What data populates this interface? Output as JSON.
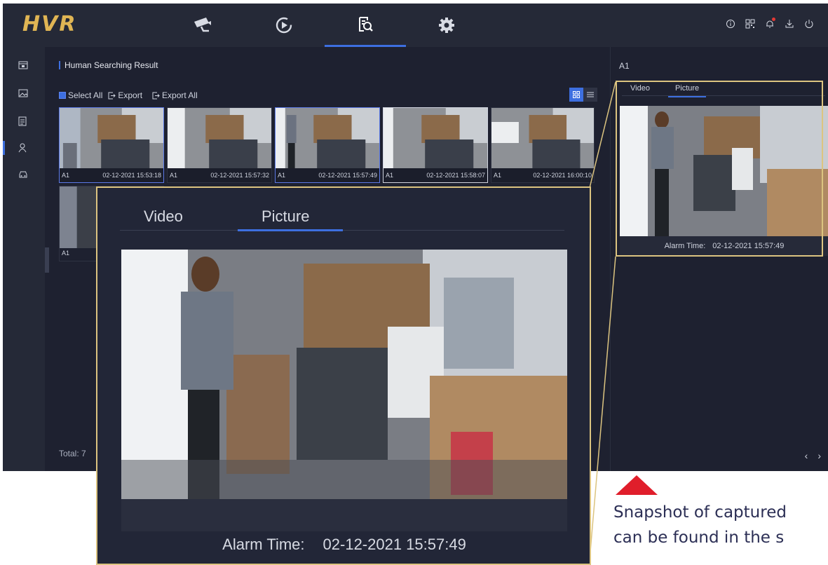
{
  "app": {
    "logo": "HVR"
  },
  "topnav": {
    "items": [
      {
        "name": "live-view",
        "icon": "camera-icon"
      },
      {
        "name": "playback",
        "icon": "playback-icon"
      },
      {
        "name": "search",
        "icon": "search-file-icon",
        "active": true
      },
      {
        "name": "configuration",
        "icon": "gear-icon"
      }
    ],
    "right_icons": [
      "info-icon",
      "qr-code-icon",
      "bell-icon",
      "download-icon",
      "power-icon"
    ]
  },
  "sidebar": {
    "items": [
      {
        "icon": "video-file-icon"
      },
      {
        "icon": "picture-icon"
      },
      {
        "icon": "document-icon"
      },
      {
        "icon": "person-icon",
        "active": true
      },
      {
        "icon": "vehicle-icon"
      }
    ]
  },
  "main": {
    "title": "Human Searching Result",
    "toolbar": {
      "select_all": "Select All",
      "export": "Export",
      "export_all": "Export All"
    },
    "results": [
      {
        "channel": "A1",
        "time": "02-12-2021 15:53:18"
      },
      {
        "channel": "A1",
        "time": "02-12-2021 15:57:32"
      },
      {
        "channel": "A1",
        "time": "02-12-2021 15:57:49"
      },
      {
        "channel": "A1",
        "time": "02-12-2021 15:58:07"
      },
      {
        "channel": "A1",
        "time": "02-12-2021 16:00:10"
      },
      {
        "channel": "A1",
        "time": ""
      }
    ],
    "total": "Total: 7"
  },
  "detail": {
    "title": "A1",
    "tab_video": "Video",
    "tab_picture": "Picture",
    "alarm_label": "Alarm Time:",
    "alarm_time": "02-12-2021 15:57:49",
    "prev": "‹",
    "next": "›"
  },
  "callout": {
    "tab_video": "Video",
    "tab_picture": "Picture",
    "alarm_label": "Alarm Time:",
    "alarm_time": "02-12-2021 15:57:49"
  },
  "annotation": {
    "line1": "Snapshot of captured",
    "line2": "can be found in the s"
  },
  "colors": {
    "accent": "#3d6fe0",
    "logo": "#e0b554",
    "highlight": "#dcc480",
    "arrow": "#e01e2b"
  }
}
